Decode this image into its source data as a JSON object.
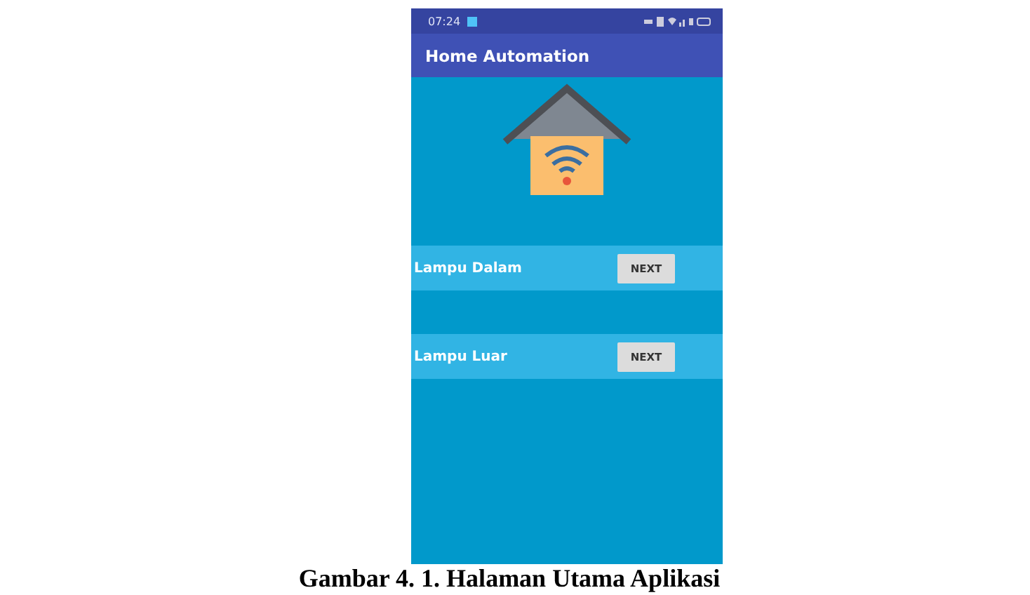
{
  "status_bar": {
    "time": "07:24"
  },
  "app_bar": {
    "title": "Home Automation"
  },
  "rows": [
    {
      "label": "Lampu Dalam",
      "button": "NEXT"
    },
    {
      "label": "Lampu Luar",
      "button": "NEXT"
    }
  ],
  "caption": "Gambar 4. 1. Halaman Utama Aplikasi"
}
